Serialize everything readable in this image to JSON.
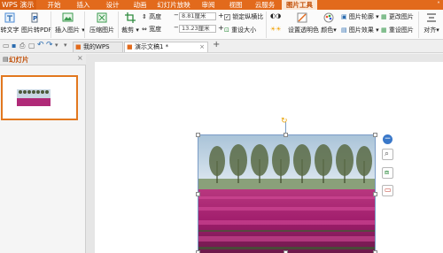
{
  "app": {
    "brand": "WPS 演示"
  },
  "ribbon_tabs": [
    "开始",
    "插入",
    "设计",
    "动画",
    "幻灯片放映",
    "审阅",
    "视图",
    "云服务",
    "图片工具"
  ],
  "active_tab": "图片工具",
  "ribbon": {
    "to_text": "转文字",
    "to_pdf": "图片转PDF",
    "insert_picture": "插入图片",
    "compress": "压缩图片",
    "crop": "裁剪",
    "height_label": "高度",
    "height_value": "8.81厘米",
    "width_label": "宽度",
    "width_value": "13.23厘米",
    "lock_ratio": "锁定纵横比",
    "reset_size": "重设大小",
    "transparent": "设置透明色",
    "color": "颜色",
    "outline": "图片轮廓",
    "effect": "图片效果",
    "change_picture": "更改图片",
    "reset_picture": "重设图片",
    "align": "对齐"
  },
  "doc_tabs": [
    "我的WPS",
    "演示文稿1 *"
  ],
  "panel": {
    "tab_label": "幻灯片"
  }
}
